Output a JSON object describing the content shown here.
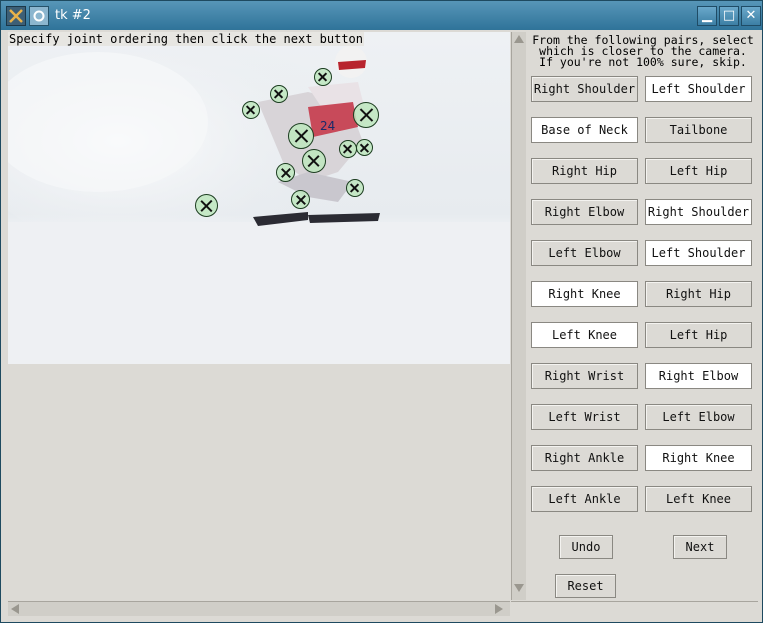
{
  "window": {
    "title": "tk #2",
    "minimize_glyph": "▁",
    "maximize_glyph": "□",
    "close_glyph": "✕"
  },
  "canvas": {
    "instruction": "Specify joint ordering then click the next button",
    "joint_count": 14
  },
  "panel": {
    "prompt": "From the following pairs, select\nwhich is closer to the camera.\nIf you're not 100% sure, skip.",
    "pairs": [
      {
        "left": "Right Shoulder",
        "right": "Left Shoulder",
        "selected": "right"
      },
      {
        "left": "Base of Neck",
        "right": "Tailbone",
        "selected": "left"
      },
      {
        "left": "Right Hip",
        "right": "Left Hip",
        "selected": "none"
      },
      {
        "left": "Right Elbow",
        "right": "Right Shoulder",
        "selected": "right"
      },
      {
        "left": "Left Elbow",
        "right": "Left Shoulder",
        "selected": "right"
      },
      {
        "left": "Right Knee",
        "right": "Right Hip",
        "selected": "left"
      },
      {
        "left": "Left Knee",
        "right": "Left Hip",
        "selected": "left"
      },
      {
        "left": "Right Wrist",
        "right": "Right Elbow",
        "selected": "right"
      },
      {
        "left": "Left Wrist",
        "right": "Left Elbow",
        "selected": "none"
      },
      {
        "left": "Right Ankle",
        "right": "Right Knee",
        "selected": "right"
      },
      {
        "left": "Left Ankle",
        "right": "Left Knee",
        "selected": "none"
      }
    ],
    "undo_label": "Undo",
    "next_label": "Next",
    "reset_label": "Reset"
  },
  "colors": {
    "selected_button": "#ffffff",
    "normal_button": "#dcdad5",
    "joint_fill": "#bee6be",
    "titlebar": "#3f81a8"
  }
}
